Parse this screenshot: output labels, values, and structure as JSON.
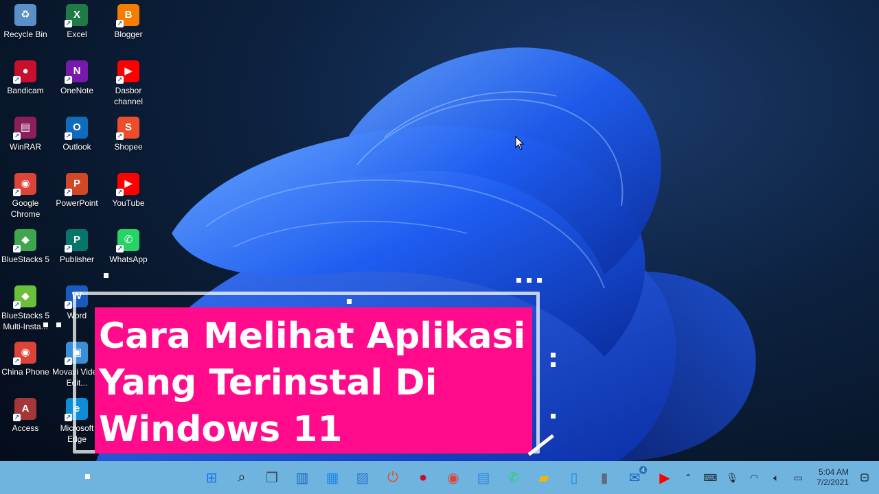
{
  "desktop": {
    "icons": [
      {
        "label": "Recycle Bin",
        "icon": "recycle-bin-icon",
        "color": "#5a8fc7"
      },
      {
        "label": "Excel",
        "icon": "excel-icon",
        "color": "#1f7a45",
        "glyph": "X"
      },
      {
        "label": "Blogger",
        "icon": "blogger-icon",
        "color": "#f57d00",
        "glyph": "B"
      },
      {
        "label": "Bandicam",
        "icon": "bandicam-icon",
        "color": "#c8102e",
        "glyph": "●"
      },
      {
        "label": "OneNote",
        "icon": "onenote-icon",
        "color": "#7719aa",
        "glyph": "N"
      },
      {
        "label": "Dasbor channel",
        "icon": "youtube-studio-icon",
        "color": "#ff0000",
        "glyph": "▶"
      },
      {
        "label": "WinRAR",
        "icon": "winrar-icon",
        "color": "#8a1f5c",
        "glyph": "▤"
      },
      {
        "label": "Outlook",
        "icon": "outlook-icon",
        "color": "#0f6cbd",
        "glyph": "O"
      },
      {
        "label": "Shopee",
        "icon": "shopee-icon",
        "color": "#ee4d2d",
        "glyph": "S"
      },
      {
        "label": "Google Chrome",
        "icon": "chrome-icon",
        "color": "#db4437",
        "glyph": "◉"
      },
      {
        "label": "PowerPoint",
        "icon": "powerpoint-icon",
        "color": "#d24726",
        "glyph": "P"
      },
      {
        "label": "YouTube",
        "icon": "youtube-icon",
        "color": "#ff0000",
        "glyph": "▶"
      },
      {
        "label": "BlueStacks 5",
        "icon": "bluestacks-icon",
        "color": "#3fa64b",
        "glyph": "◆"
      },
      {
        "label": "Publisher",
        "icon": "publisher-icon",
        "color": "#077568",
        "glyph": "P"
      },
      {
        "label": "WhatsApp",
        "icon": "whatsapp-icon",
        "color": "#25d366",
        "glyph": "✆"
      },
      {
        "label": "BlueStacks 5 Multi-Insta...",
        "icon": "bluestacks-multi-icon",
        "color": "#6abf3b",
        "glyph": "◆"
      },
      {
        "label": "Word",
        "icon": "word-icon",
        "color": "#185abd",
        "glyph": "W"
      },
      {
        "label": "China Phone",
        "icon": "china-phone-chrome-icon",
        "color": "#db4437",
        "glyph": "◉"
      },
      {
        "label": "Movavi Video Edit...",
        "icon": "movavi-icon",
        "color": "#3a8fd8",
        "glyph": "▣"
      },
      {
        "label": "Access",
        "icon": "access-icon",
        "color": "#a4373a",
        "glyph": "A"
      },
      {
        "label": "Microsoft Edge",
        "icon": "edge-icon",
        "color": "#0c8dd6",
        "glyph": "e"
      }
    ]
  },
  "banner": {
    "lines": [
      "Cara Melihat Aplikasi",
      "Yang Terinstal Di",
      "Windows 11"
    ],
    "color": "#ff0b8b"
  },
  "taskbar": {
    "color": "#6fb4df",
    "apps": [
      {
        "icon": "start-icon",
        "label": "Start"
      },
      {
        "icon": "search-icon",
        "label": "Search"
      },
      {
        "icon": "task-view-icon",
        "label": "Task View"
      },
      {
        "icon": "widgets-icon",
        "label": "Widgets"
      },
      {
        "icon": "microsoft-store-icon",
        "label": "Microsoft Store"
      },
      {
        "icon": "photos-icon",
        "label": "Photos"
      },
      {
        "icon": "screen-recorder-icon",
        "label": "Recorder"
      },
      {
        "icon": "bandicam-icon",
        "label": "Bandicam"
      },
      {
        "icon": "chrome-icon",
        "label": "Google Chrome"
      },
      {
        "icon": "notepad-icon",
        "label": "Notepad"
      },
      {
        "icon": "whatsapp-icon",
        "label": "WhatsApp"
      },
      {
        "icon": "file-explorer-icon",
        "label": "File Explorer"
      },
      {
        "icon": "phone-link-icon",
        "label": "Phone Link"
      },
      {
        "icon": "usb-icon",
        "label": "USB"
      },
      {
        "icon": "mail-icon",
        "label": "Mail",
        "badge": "4"
      },
      {
        "icon": "youtube-icon",
        "label": "YouTube"
      }
    ],
    "clock": {
      "time": "5:04 AM",
      "date": "7/2/2021"
    }
  }
}
